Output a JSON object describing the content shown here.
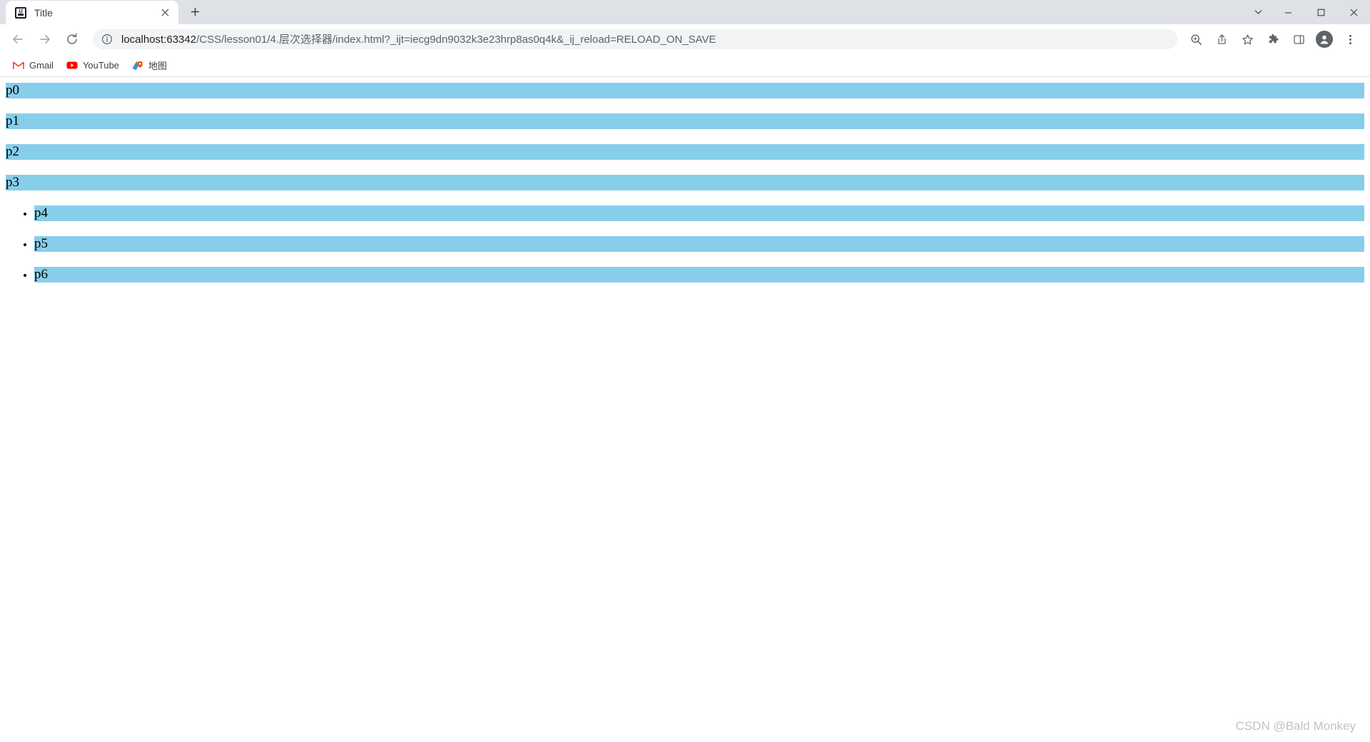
{
  "browser": {
    "tab": {
      "favicon_name": "intellij-idea-favicon",
      "favicon_text": "IJ",
      "title": "Title",
      "close_icon": "close-icon"
    },
    "new_tab_label": "+",
    "window_controls": {
      "chevron_label": "⌄",
      "minimize_label": "–",
      "maximize_label": "□",
      "close_label": "✕"
    },
    "navigation": {
      "back_icon": "back-arrow-icon",
      "forward_icon": "forward-arrow-icon",
      "reload_icon": "reload-icon"
    },
    "omnibox": {
      "info_icon": "site-info-icon",
      "host": "localhost:63342",
      "path": "/CSS/lesson01/4.层次选择器/index.html?_ijt=iecg9dn9032k3e23hrp8as0q4k&_ij_reload=RELOAD_ON_SAVE",
      "full_url": "localhost:63342/CSS/lesson01/4.层次选择器/index.html?_ijt=iecg9dn9032k3e23hrp8as0q4k&_ij_reload=RELOAD_ON_SAVE"
    },
    "toolbar_icons": [
      {
        "name": "zoom-icon"
      },
      {
        "name": "share-icon"
      },
      {
        "name": "bookmark-star-icon"
      },
      {
        "name": "extensions-puzzle-icon"
      },
      {
        "name": "side-panel-icon"
      },
      {
        "name": "profile-avatar-icon"
      },
      {
        "name": "chrome-menu-icon"
      }
    ],
    "bookmarks": [
      {
        "label": "Gmail",
        "icon": "gmail-icon"
      },
      {
        "label": "YouTube",
        "icon": "youtube-icon"
      },
      {
        "label": "地图",
        "icon": "google-maps-icon"
      }
    ]
  },
  "page": {
    "paragraphs": [
      {
        "text": "p0"
      },
      {
        "text": "p1"
      },
      {
        "text": "p2"
      },
      {
        "text": "p3"
      }
    ],
    "list_items": [
      {
        "text": "p4"
      },
      {
        "text": "p5"
      },
      {
        "text": "p6"
      }
    ],
    "highlight_color": "#87ceeb",
    "watermark": "CSDN @Bald Monkey"
  }
}
